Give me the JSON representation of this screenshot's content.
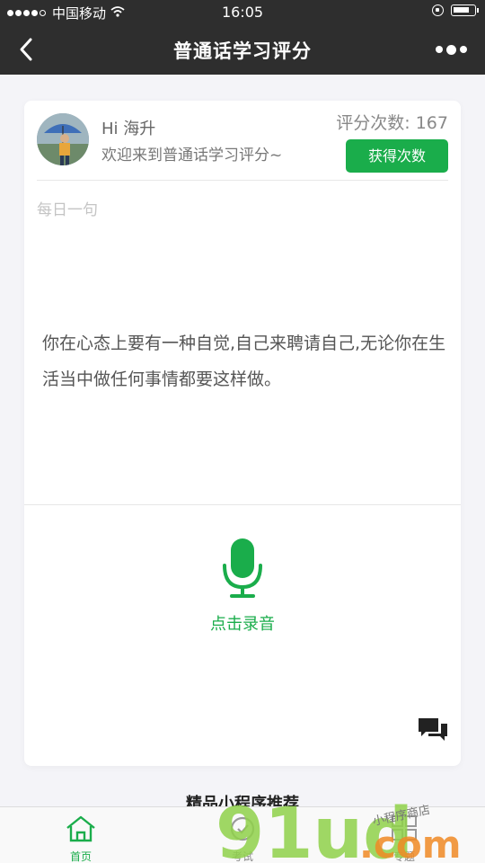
{
  "status_bar": {
    "carrier": "中国移动",
    "time": "16:05",
    "signal_bars_filled": 4,
    "battery_level": 0.8
  },
  "nav": {
    "title": "普通话学习评分",
    "back_icon": "chevron-left-icon",
    "more_icon": "more-dots-icon"
  },
  "user": {
    "greeting": "Hi 海升",
    "welcome": "欢迎来到普通话学习评分~",
    "score_count": "评分次数: 167",
    "get_more_label": "获得次数"
  },
  "daily": {
    "label": "每日一句",
    "quote": "你在心态上要有一种自觉,自己来聘请自己,无论你在生活当中做任何事情都要这样做。"
  },
  "record": {
    "label": "点击录音",
    "icon": "microphone-icon"
  },
  "recommend": {
    "title": "精品小程序推荐"
  },
  "tabs": [
    {
      "label": "首页",
      "icon": "home-icon",
      "active": true
    },
    {
      "label": "考试",
      "icon": "exam-icon",
      "active": false
    },
    {
      "label": "专题",
      "icon": "grid-icon",
      "active": false
    }
  ],
  "watermark": {
    "text": "91ud",
    "suffix": ".com",
    "tagline": "小程序商店"
  },
  "colors": {
    "accent": "#1aad4b",
    "header": "#2e2e2e",
    "background": "#f4f4f8"
  }
}
